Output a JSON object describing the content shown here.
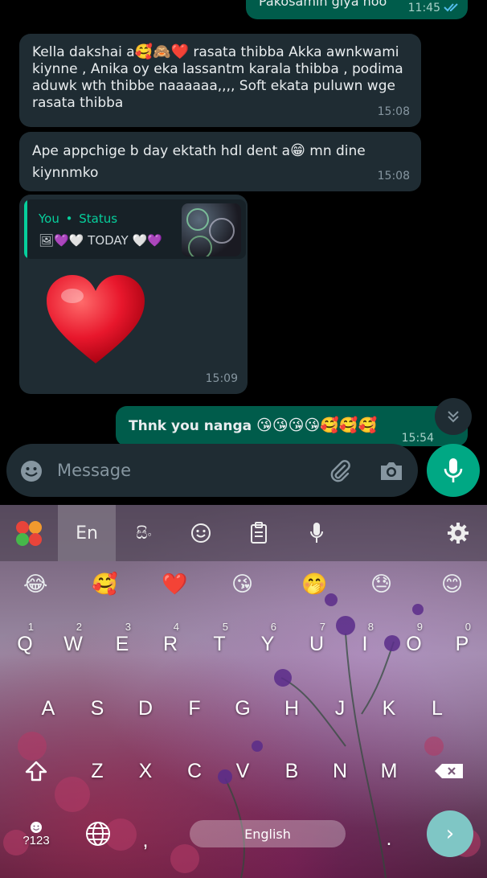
{
  "messages": {
    "top_partial": {
      "text": "Pakosamin giya hoo",
      "time": "11:45"
    },
    "msg1": {
      "line1_pre": "Kella dakshai a",
      "line1_emojis": [
        "🥰",
        "🙈",
        "❤️"
      ],
      "line1_post": " rasata thibba Akka awnkwami",
      "line2": "kiynne , Anika oy eka lassantm karala thibba , podima",
      "line3": "aduwk wth thibbe naaaaaa,,,, Soft ekata puluwn wge",
      "line4": "rasata thibba",
      "time": "15:08"
    },
    "msg2": {
      "line1_pre": "Ape appchige b day ektath hdl dent a",
      "line1_emoji": "😁",
      "line1_post": " mn dine",
      "line2": "kiynnmko",
      "time": "15:08"
    },
    "msg3": {
      "quote_author": "You",
      "quote_sep": "•",
      "quote_label": "Status",
      "quote_text": "🖼💜🤍 TODAY 🤍💜",
      "time": "15:09"
    },
    "msg4": {
      "text": "Thnk you nanga ",
      "emojis": "😘😘😘😘🥰🥰🥰",
      "time": "15:54"
    }
  },
  "input": {
    "placeholder": "Message"
  },
  "keyboard": {
    "language_tab": "En",
    "sinhala_tab": "සිං",
    "emoji_suggestions": [
      "😂",
      "🥰",
      "❤️",
      "😘",
      "🤭",
      "😓",
      "😊"
    ],
    "row1": [
      "Q",
      "W",
      "E",
      "R",
      "T",
      "Y",
      "U",
      "I",
      "O",
      "P"
    ],
    "row1_hints": [
      "1",
      "2",
      "3",
      "4",
      "5",
      "6",
      "7",
      "8",
      "9",
      "0"
    ],
    "row2": [
      "A",
      "S",
      "D",
      "F",
      "G",
      "H",
      "J",
      "K",
      "L"
    ],
    "row3": [
      "Z",
      "X",
      "C",
      "V",
      "B",
      "N",
      "M"
    ],
    "symbols_key": "?123",
    "comma": ",",
    "period": ".",
    "space_label": "English",
    "enter": "›"
  },
  "colors": {
    "incoming_bubble": "#1f2c33",
    "outgoing_bubble": "#005c4b",
    "accent": "#00a884",
    "quote_accent": "#06cf9c"
  }
}
